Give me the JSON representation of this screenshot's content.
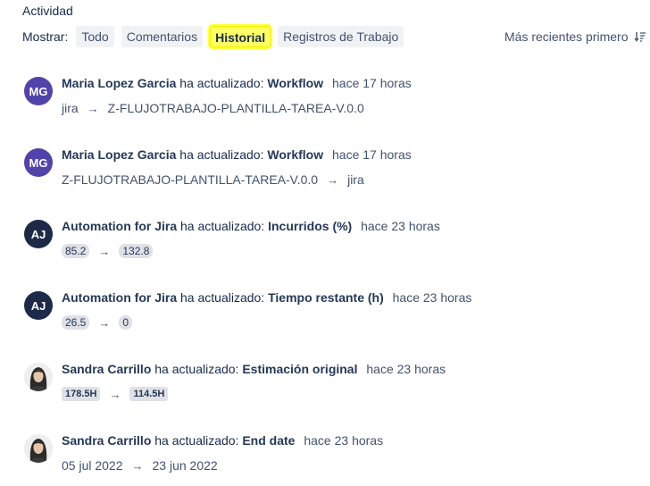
{
  "header": {
    "title": "Actividad",
    "show_label": "Mostrar:",
    "filters": [
      "Todo",
      "Comentarios",
      "Historial",
      "Registros de Trabajo"
    ],
    "active_filter": "Historial",
    "sort_label": "Más recientes primero"
  },
  "entries": [
    {
      "initials": "MG",
      "actor": "Maria Lopez Garcia",
      "verb": "ha actualizado:",
      "field": "Workflow",
      "time": "hace 17 horas",
      "from": "jira",
      "to": "Z-FLUJOTRABAJO-PLANTILLA-TAREA-V.0.0",
      "arrow": "→"
    },
    {
      "initials": "MG",
      "actor": "Maria Lopez Garcia",
      "verb": "ha actualizado:",
      "field": "Workflow",
      "time": "hace 17 horas",
      "from": "Z-FLUJOTRABAJO-PLANTILLA-TAREA-V.0.0",
      "to": "jira",
      "arrow": "→"
    },
    {
      "initials": "AJ",
      "actor": "Automation for Jira",
      "verb": "ha actualizado:",
      "field": "Incurridos (%)",
      "time": "hace 23 horas",
      "from": "85.2",
      "to": "132.8",
      "arrow": "→"
    },
    {
      "initials": "AJ",
      "actor": "Automation for Jira",
      "verb": "ha actualizado:",
      "field": "Tiempo restante (h)",
      "time": "hace 23 horas",
      "from": "26.5",
      "to": "0",
      "arrow": "→"
    },
    {
      "actor": "Sandra Carrillo",
      "verb": "ha actualizado:",
      "field": "Estimación original",
      "time": "hace 23 horas",
      "from": "178.5H",
      "to": "114.5H",
      "arrow": "→"
    },
    {
      "actor": "Sandra Carrillo",
      "verb": "ha actualizado:",
      "field": "End date",
      "time": "hace 23 horas",
      "from": "05 jul 2022",
      "to": "23 jun 2022",
      "arrow": "→"
    }
  ],
  "colors": {
    "highlight": "#ffff66",
    "avatar_mg": "#5243aa",
    "avatar_aj": "#1d2a47",
    "lozenge": "#dfe1e6"
  }
}
